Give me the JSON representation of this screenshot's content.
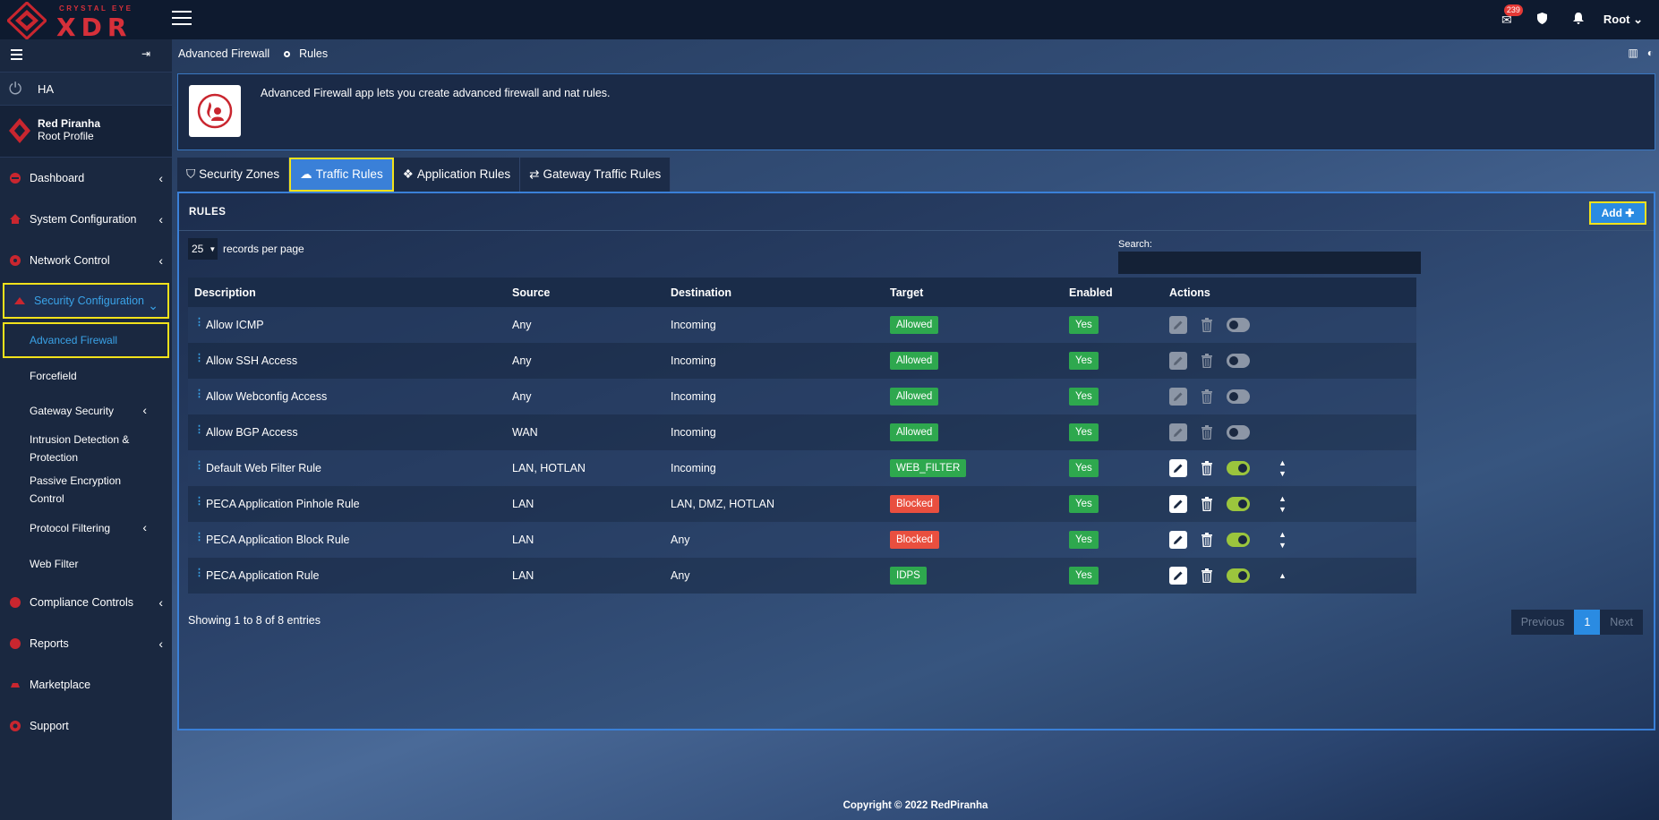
{
  "brand": {
    "small": "CRYSTAL EYE",
    "big": "XDR"
  },
  "topbar": {
    "mail_badge": "239",
    "user": "Root"
  },
  "icons": {
    "menu": "hamburger-icon",
    "mail": "envelope-icon",
    "shield": "shield-icon",
    "bell": "bell-icon",
    "logout": "sign-out-icon",
    "power": "power-icon"
  },
  "sidebar": {
    "ha_label": "HA",
    "profile_name": "Red Piranha",
    "profile_role": "Root Profile",
    "items": [
      {
        "label": "Dashboard"
      },
      {
        "label": "System Configuration"
      },
      {
        "label": "Network Control"
      },
      {
        "label": "Security Configuration"
      },
      {
        "label": "Compliance Controls"
      },
      {
        "label": "Reports"
      },
      {
        "label": "Marketplace"
      },
      {
        "label": "Support"
      }
    ],
    "subitems": [
      {
        "label": "Advanced Firewall"
      },
      {
        "label": "Forcefield"
      },
      {
        "label": "Gateway Security"
      },
      {
        "label": "Intrusion Detection &"
      },
      {
        "label": "Protection"
      },
      {
        "label": "Passive Encryption"
      },
      {
        "label": "Control"
      },
      {
        "label": "Protocol Filtering"
      },
      {
        "label": "Web Filter"
      }
    ]
  },
  "breadcrumb": {
    "parent": "Advanced Firewall",
    "current": "Rules"
  },
  "info": {
    "description": "Advanced Firewall app lets you create advanced firewall and nat rules."
  },
  "tabs": [
    {
      "label": "Security Zones"
    },
    {
      "label": "Traffic Rules"
    },
    {
      "label": "Application Rules"
    },
    {
      "label": "Gateway Traffic Rules"
    }
  ],
  "panel": {
    "title": "RULES",
    "add_label": "Add ✚",
    "rpp_value": "25",
    "rpp_label": "records per page",
    "search_label": "Search:",
    "search_value": ""
  },
  "table": {
    "headers": {
      "description": "Description",
      "source": "Source",
      "destination": "Destination",
      "target": "Target",
      "enabled": "Enabled",
      "actions": "Actions"
    },
    "rows": [
      {
        "description": "Allow ICMP",
        "source": "Any",
        "destination": "Incoming",
        "target": "Allowed",
        "target_color": "#2ea84e",
        "enabled": "Yes"
      },
      {
        "description": "Allow SSH Access",
        "source": "Any",
        "destination": "Incoming",
        "target": "Allowed",
        "target_color": "#2ea84e",
        "enabled": "Yes"
      },
      {
        "description": "Allow Webconfig Access",
        "source": "Any",
        "destination": "Incoming",
        "target": "Allowed",
        "target_color": "#2ea84e",
        "enabled": "Yes"
      },
      {
        "description": "Allow BGP Access",
        "source": "WAN",
        "destination": "Incoming",
        "target": "Allowed",
        "target_color": "#2ea84e",
        "enabled": "Yes"
      },
      {
        "description": "Default Web Filter Rule",
        "source": "LAN, HOTLAN",
        "destination": "Incoming",
        "target": "WEB_FILTER",
        "target_color": "#2ea84e",
        "enabled": "Yes"
      },
      {
        "description": "PECA Application Pinhole Rule",
        "source": "LAN",
        "destination": "LAN, DMZ, HOTLAN",
        "target": "Blocked",
        "target_color": "#e94f3f",
        "enabled": "Yes"
      },
      {
        "description": "PECA Application Block Rule",
        "source": "LAN",
        "destination": "Any",
        "target": "Blocked",
        "target_color": "#e94f3f",
        "enabled": "Yes"
      },
      {
        "description": "PECA Application Rule",
        "source": "LAN",
        "destination": "Any",
        "target": "IDPS",
        "target_color": "#2ea84e",
        "enabled": "Yes"
      }
    ]
  },
  "footer_info": {
    "showing": "Showing 1 to 8 of 8 entries"
  },
  "pager": {
    "previous": "Previous",
    "current": "1",
    "next": "Next"
  },
  "copyright": "Copyright © 2022 RedPiranha",
  "colors": {
    "accent": "#2a8be2",
    "highlight": "#f2e21b",
    "allowed": "#2ea84e",
    "blocked": "#e94f3f",
    "toggle_on": "#9bc53d"
  }
}
